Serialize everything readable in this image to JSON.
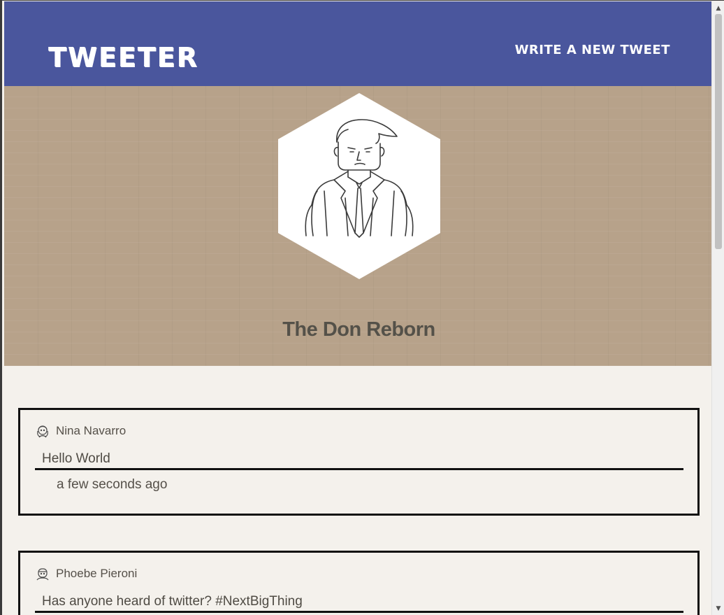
{
  "header": {
    "logo": "TWEETER",
    "write_link": "WRITE A NEW TWEET"
  },
  "profile": {
    "name": "The Don Reborn",
    "avatar_icon": "hexagon-avatar-icon"
  },
  "tweets": [
    {
      "user": "Nina Navarro",
      "icon": "girl-avatar-icon",
      "text": "Hello World",
      "time": "a few seconds ago"
    },
    {
      "user": "Phoebe Pieroni",
      "icon": "woman-avatar-icon",
      "text": "Has anyone heard of twitter? #NextBigThing",
      "time": ""
    }
  ],
  "colors": {
    "header": "#4a569d",
    "banner": "#b7a28a",
    "background": "#f4f1ec",
    "text": "#555049"
  }
}
